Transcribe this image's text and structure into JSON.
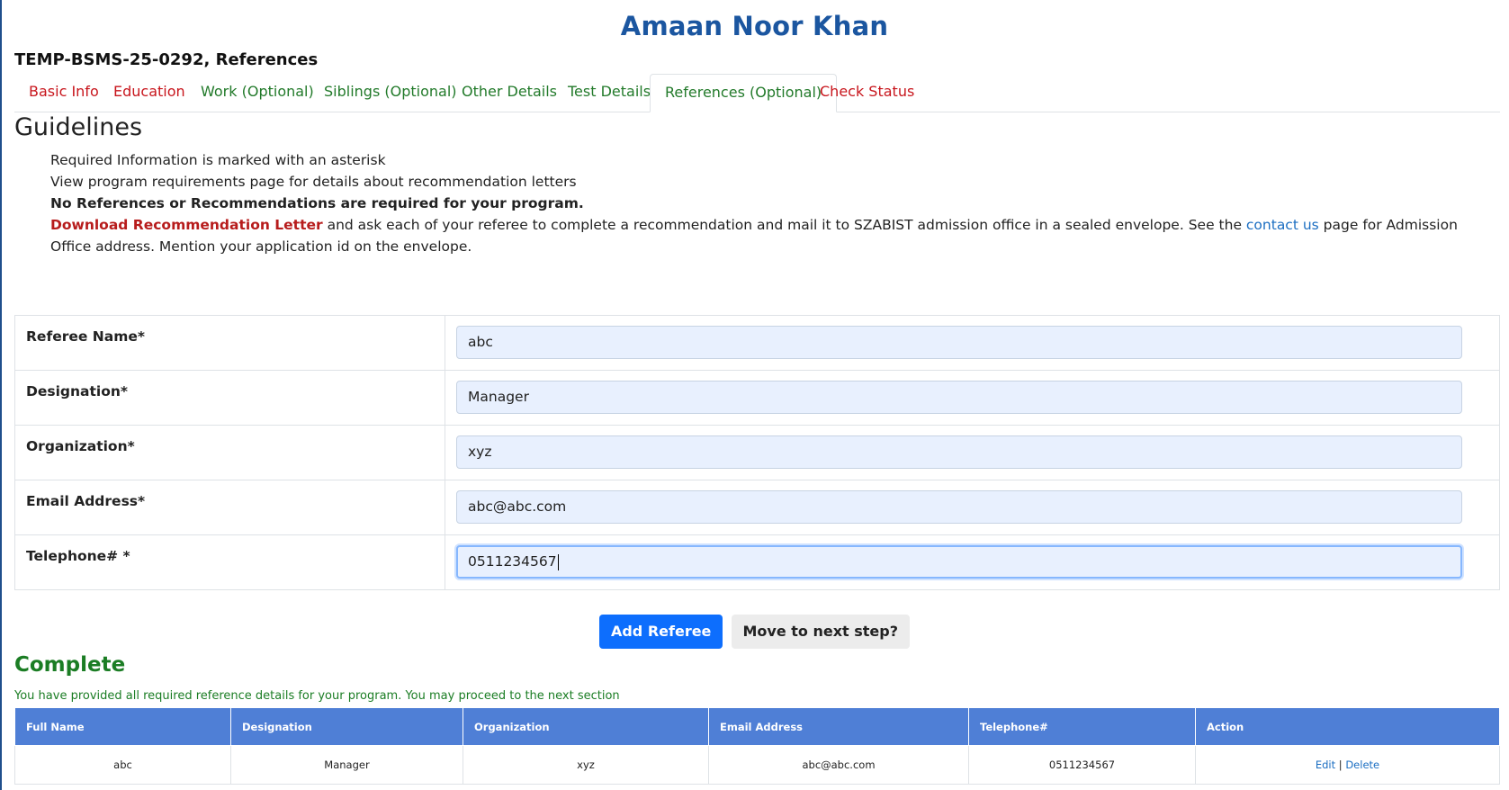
{
  "header": {
    "applicant_name": "Amaan Noor Khan",
    "subtitle": "TEMP-BSMS-25-0292, References"
  },
  "tabs": [
    {
      "label": "Basic Info",
      "status": "incomplete"
    },
    {
      "label": "Education",
      "status": "incomplete"
    },
    {
      "label": "Work (Optional)",
      "status": "complete"
    },
    {
      "label": "Siblings (Optional)",
      "status": "complete"
    },
    {
      "label": "Other Details",
      "status": "complete"
    },
    {
      "label": "Test Details",
      "status": "complete"
    },
    {
      "label": "References (Optional)",
      "status": "complete",
      "active": true
    },
    {
      "label": "Check Status",
      "status": "incomplete"
    }
  ],
  "guidelines": {
    "title": "Guidelines",
    "line1": "Required Information is marked with an asterisk",
    "line2": "View program requirements page for details about recommendation letters",
    "line3": "No References or Recommendations are required for your program.",
    "download_link": "Download Recommendation Letter",
    "line4_part1": " and ask each of your referee to complete a recommendation and mail it to SZABIST admission office in a sealed envelope. See the ",
    "contact_link": "contact us",
    "line4_part2": " page for Admission Office address. Mention your application id on the envelope."
  },
  "form": {
    "referee_name": {
      "label": "Referee Name*",
      "value": "abc"
    },
    "designation": {
      "label": "Designation*",
      "value": "Manager"
    },
    "organization": {
      "label": "Organization*",
      "value": "xyz"
    },
    "email": {
      "label": "Email Address*",
      "value": "abc@abc.com"
    },
    "telephone": {
      "label": "Telephone# *",
      "value": "0511234567"
    }
  },
  "buttons": {
    "add_referee": "Add Referee",
    "next_step": "Move to next step?"
  },
  "status": {
    "title": "Complete",
    "message": "You have provided all required reference details for your program. You may proceed to the next section"
  },
  "referees_table": {
    "headers": [
      "Full Name",
      "Designation",
      "Organization",
      "Email Address",
      "Telephone#",
      "Action"
    ],
    "rows": [
      {
        "name": "abc",
        "designation": "Manager",
        "organization": "xyz",
        "email": "abc@abc.com",
        "telephone": "0511234567",
        "edit": "Edit",
        "separator": "|",
        "delete": "Delete"
      }
    ]
  },
  "colors": {
    "title_blue": "#1b56a0",
    "tab_incomplete": "#c8161d",
    "tab_complete": "#227a2a",
    "table_header": "#4f7fd6",
    "primary_button": "#0d6efd"
  }
}
